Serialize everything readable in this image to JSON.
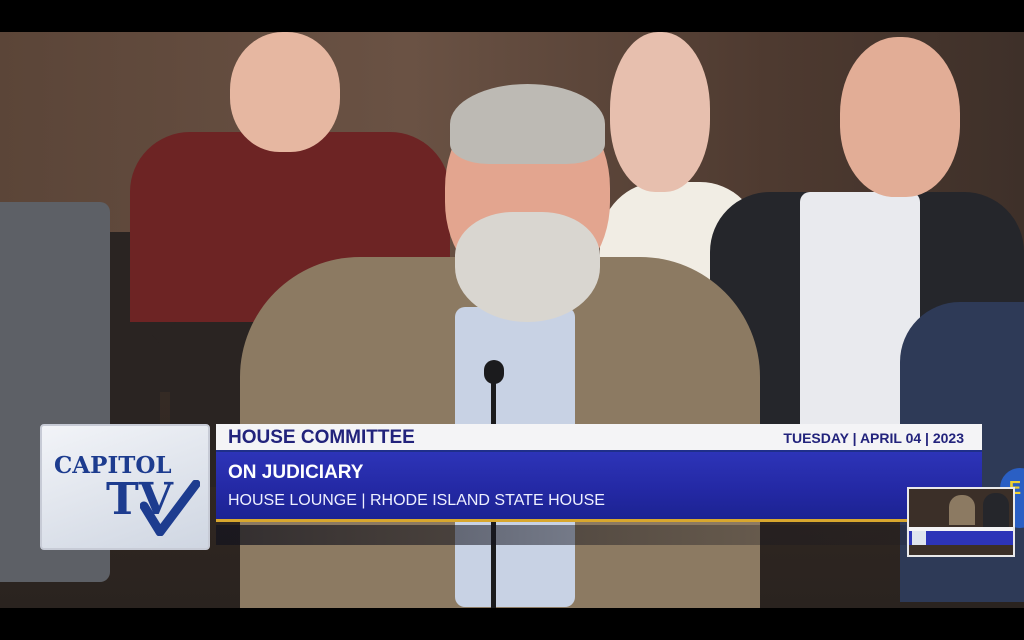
{
  "broadcast": {
    "logo": {
      "line1": "CAPITOL",
      "line2": "TV"
    },
    "headline": "HOUSE COMMITTEE",
    "date": "TUESDAY | APRIL 04 | 2023",
    "committee": "ON JUDICIARY",
    "location": "HOUSE LOUNGE | RHODE ISLAND STATE HOUSE"
  },
  "colors": {
    "banner_blue": "#2328a3",
    "title_text": "#22237c",
    "accent_gold": "#d8a72e"
  }
}
